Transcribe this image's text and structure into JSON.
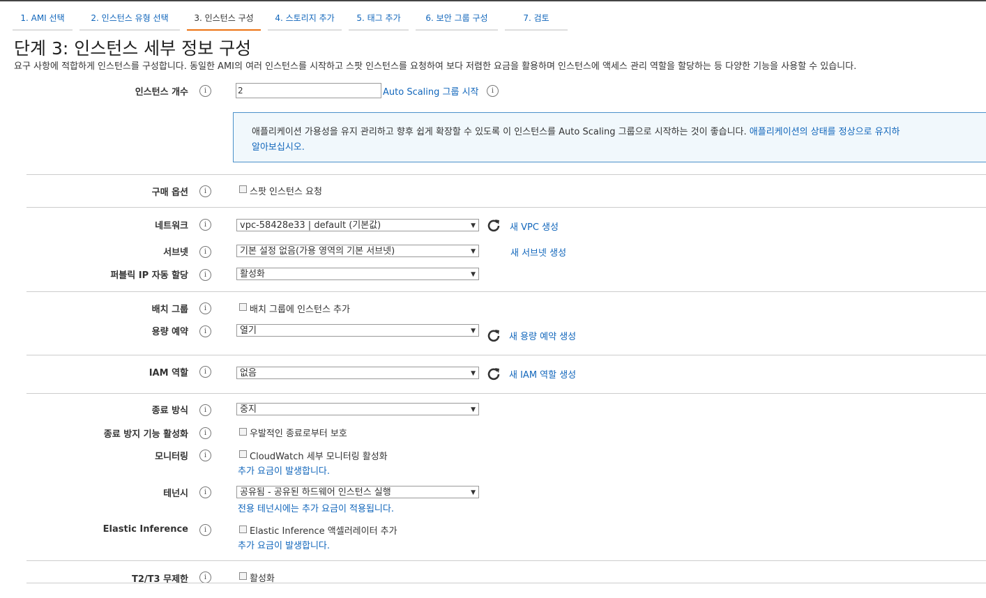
{
  "tabs": [
    {
      "label": "1. AMI 선택"
    },
    {
      "label": "2. 인스턴스 유형 선택"
    },
    {
      "label": "3. 인스턴스 구성"
    },
    {
      "label": "4. 스토리지 추가"
    },
    {
      "label": "5. 태그 추가"
    },
    {
      "label": "6. 보안 그룹 구성"
    },
    {
      "label": "7. 검토"
    }
  ],
  "page": {
    "title": "단계 3: 인스턴스 세부 정보 구성",
    "description": "요구 사항에 적합하게 인스턴스를 구성합니다. 동일한 AMI의 여러 인스턴스를 시작하고 스팟 인스턴스를 요청하여 보다 저렴한 요금을 활용하며 인스턴스에 액세스 관리 역할을 할당하는 등 다양한 기능을 사용할 수 있습니다."
  },
  "instance_count": {
    "label": "인스턴스 개수",
    "value": "2",
    "link": "Auto Scaling 그룹 시작"
  },
  "notice": {
    "text": "애플리케이션 가용성을 유지 관리하고 향후 쉽게 확장할 수 있도록 이 인스턴스를 Auto Scaling 그룹으로 시작하는 것이 좋습니다.",
    "link1": "애플리케이션의 상태를 정상으로 유지하",
    "link2": "알아보십시오."
  },
  "purchase": {
    "label": "구매 옵션",
    "checkbox": "스팟 인스턴스 요청"
  },
  "network": {
    "label": "네트워크",
    "value": "vpc-58428e33 | default (기본값)",
    "link": "새 VPC 생성"
  },
  "subnet": {
    "label": "서브넷",
    "value": "기본 설정 없음(가용 영역의 기본 서브넷)",
    "link": "새 서브넷 생성"
  },
  "public_ip": {
    "label": "퍼블릭 IP 자동 할당",
    "value": "활성화"
  },
  "placement": {
    "label": "배치 그룹",
    "checkbox": "배치 그룹에 인스턴스 추가"
  },
  "capacity": {
    "label": "용량 예약",
    "value": "열기",
    "link": "새 용량 예약 생성"
  },
  "iam": {
    "label": "IAM 역할",
    "value": "없음",
    "link": "새 IAM 역할 생성"
  },
  "shutdown": {
    "label": "종료 방식",
    "value": "중지"
  },
  "termination": {
    "label": "종료 방지 기능 활성화",
    "checkbox": "우발적인 종료로부터 보호"
  },
  "monitoring": {
    "label": "모니터링",
    "checkbox": "CloudWatch 세부 모니터링 활성화",
    "note": "추가 요금이 발생합니다."
  },
  "tenancy": {
    "label": "테넌시",
    "value": "공유됨 - 공유된 하드웨어 인스턴스 실행",
    "note": "전용 테넌시에는 추가 요금이 적용됩니다."
  },
  "elastic": {
    "label": "Elastic Inference",
    "checkbox": "Elastic Inference 액셀러레이터 추가",
    "note": "추가 요금이 발생합니다."
  },
  "t2t3": {
    "label": "T2/T3 무제한",
    "checkbox": "활성화"
  },
  "icons": {
    "info": "info-icon",
    "refresh": "refresh-icon",
    "dropdown": "chevron-down-icon"
  },
  "colors": {
    "link": "#1166bb",
    "active_tab": "#ec7211",
    "notice_border": "#4a90c9",
    "notice_bg": "#f1f8fc"
  }
}
